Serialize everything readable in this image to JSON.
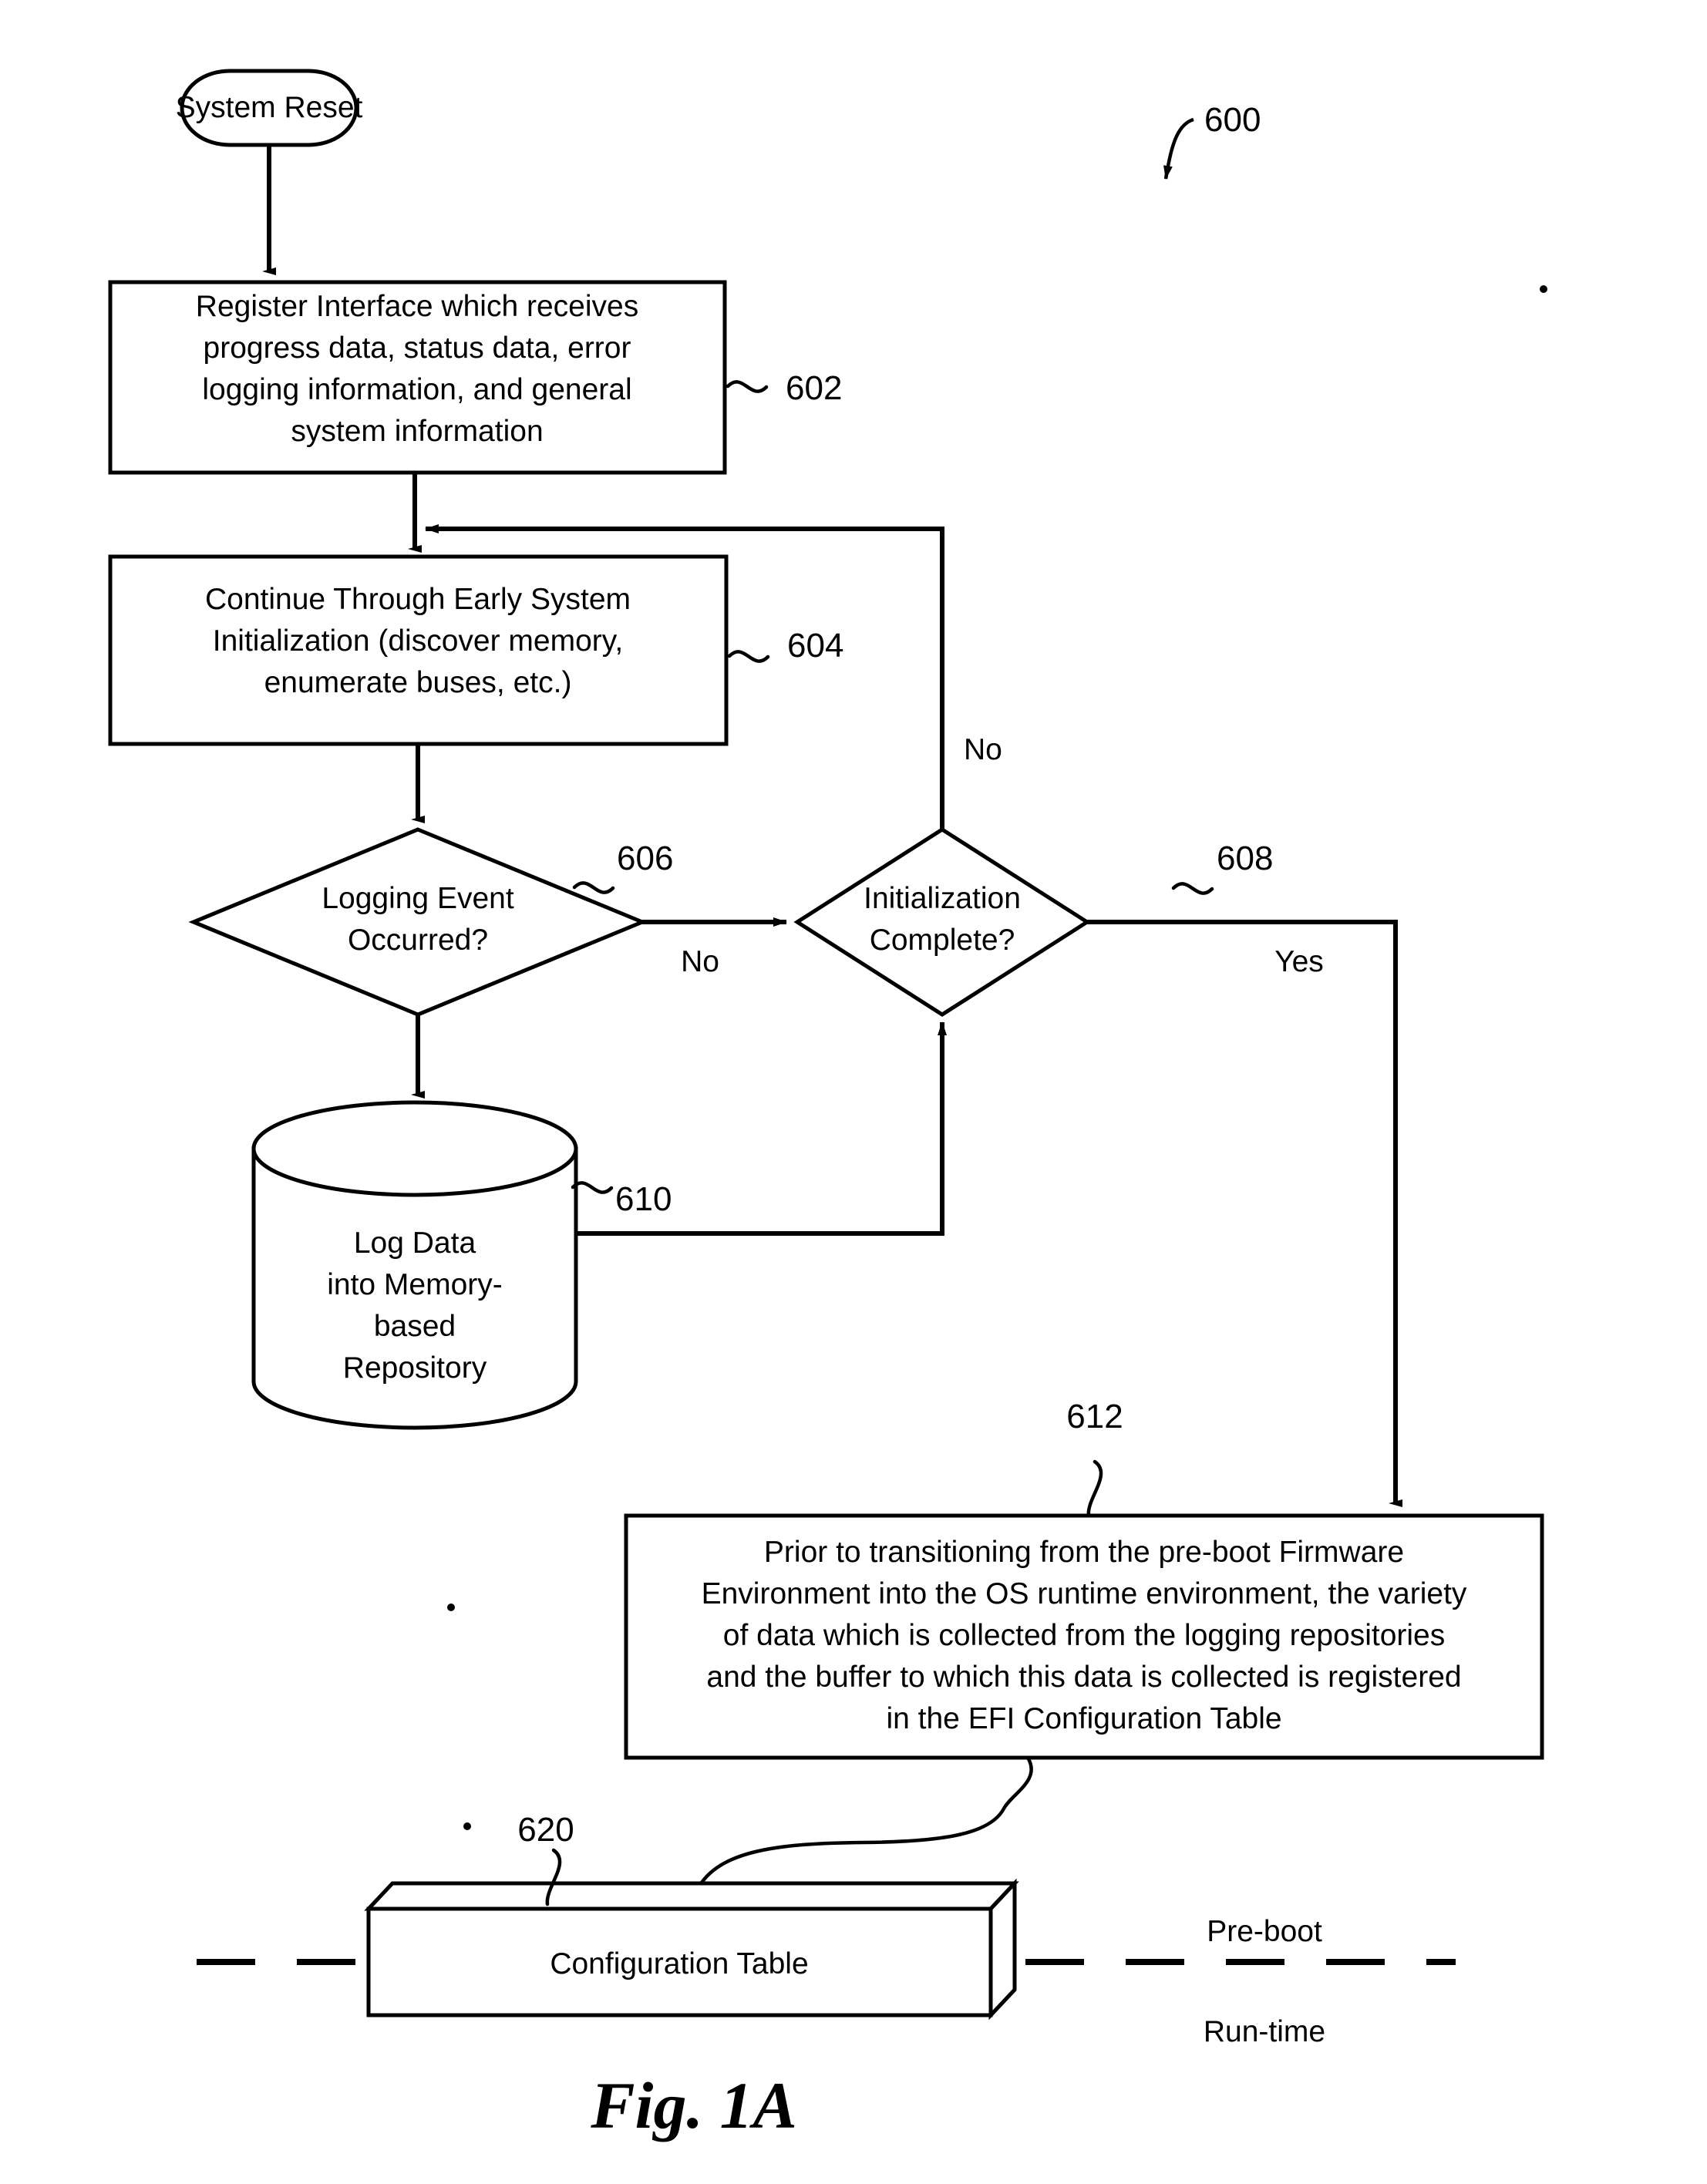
{
  "figure": {
    "caption": "Fig. 1A",
    "diagram_ref": "600",
    "type": "flowchart"
  },
  "nodes": {
    "start": {
      "ref": "",
      "label": "System Reset",
      "shape": "stadium"
    },
    "register_interface": {
      "ref": "602",
      "shape": "process",
      "lines": [
        "Register Interface which receives",
        "progress data, status data, error",
        "logging information, and general",
        "system information"
      ]
    },
    "early_init": {
      "ref": "604",
      "shape": "process",
      "lines": [
        "Continue Through Early System",
        "Initialization (discover memory,",
        "enumerate buses, etc.)"
      ]
    },
    "logging_event": {
      "ref": "606",
      "shape": "decision",
      "lines": [
        "Logging Event",
        "Occurred?"
      ]
    },
    "init_complete": {
      "ref": "608",
      "shape": "decision",
      "lines": [
        "Initialization",
        "Complete?"
      ]
    },
    "log_repository": {
      "ref": "610",
      "shape": "cylinder",
      "lines": [
        "Log Data",
        "into Memory-",
        "based",
        "Repository"
      ]
    },
    "efi_registration": {
      "ref": "612",
      "shape": "process",
      "lines": [
        "Prior to transitioning from the pre-boot Firmware",
        "Environment into the OS runtime environment, the variety",
        "of data which is collected from the logging repositories",
        "and the buffer to which this data is collected is registered",
        "in the EFI Configuration Table"
      ]
    },
    "configuration_table": {
      "ref": "620",
      "shape": "box3d",
      "label": "Configuration Table"
    }
  },
  "edge_labels": {
    "logging_event_no": "No",
    "init_complete_no": "No",
    "init_complete_yes": "Yes"
  },
  "phase_labels": {
    "above": "Pre-boot",
    "below": "Run-time"
  },
  "colors": {
    "stroke": "#000000",
    "fill": "#ffffff"
  }
}
